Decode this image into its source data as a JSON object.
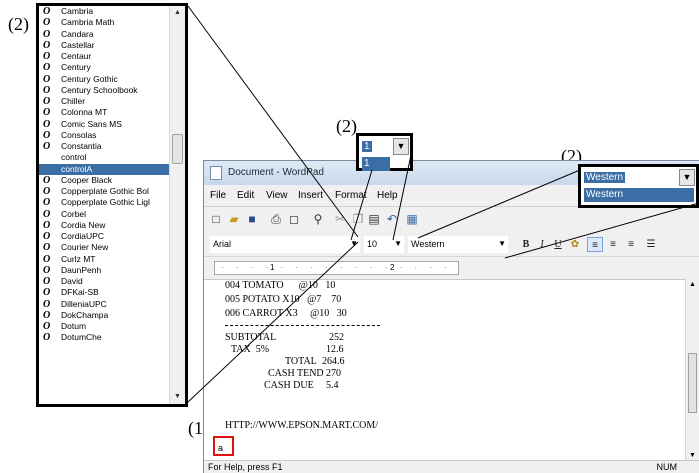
{
  "annotations": {
    "list_label": "(2)",
    "size_label": "(2)",
    "script_label": "(2)",
    "cursor_label": "(1)"
  },
  "font_list": {
    "items": [
      {
        "name": "Cambria",
        "icon": "opentype-icon",
        "state": "normal"
      },
      {
        "name": "Cambria Math",
        "icon": "opentype-icon",
        "state": "normal"
      },
      {
        "name": "Candara",
        "icon": "opentype-icon",
        "state": "normal"
      },
      {
        "name": "Castellar",
        "icon": "opentype-icon",
        "state": "normal"
      },
      {
        "name": "Centaur",
        "icon": "opentype-icon",
        "state": "normal"
      },
      {
        "name": "Century",
        "icon": "opentype-icon",
        "state": "normal"
      },
      {
        "name": "Century Gothic",
        "icon": "opentype-icon",
        "state": "normal"
      },
      {
        "name": "Century Schoolbook",
        "icon": "opentype-icon",
        "state": "normal"
      },
      {
        "name": "Chiller",
        "icon": "opentype-icon",
        "state": "normal"
      },
      {
        "name": "Colonna MT",
        "icon": "opentype-icon",
        "state": "normal"
      },
      {
        "name": "Comic Sans MS",
        "icon": "opentype-icon",
        "state": "normal"
      },
      {
        "name": "Consolas",
        "icon": "opentype-icon",
        "state": "normal"
      },
      {
        "name": "Constantia",
        "icon": "opentype-icon",
        "state": "normal"
      },
      {
        "name": "control",
        "icon": "",
        "state": "plain"
      },
      {
        "name": "controlA",
        "icon": "",
        "state": "selected"
      },
      {
        "name": "Cooper Black",
        "icon": "opentype-icon",
        "state": "normal"
      },
      {
        "name": "Copperplate Gothic Bol",
        "icon": "opentype-icon",
        "state": "normal"
      },
      {
        "name": "Copperplate Gothic Ligl",
        "icon": "opentype-icon",
        "state": "normal"
      },
      {
        "name": "Corbel",
        "icon": "opentype-icon",
        "state": "normal"
      },
      {
        "name": "Cordia New",
        "icon": "opentype-icon",
        "state": "normal"
      },
      {
        "name": "CordiaUPC",
        "icon": "opentype-icon",
        "state": "normal"
      },
      {
        "name": "Courier New",
        "icon": "opentype-icon",
        "state": "normal"
      },
      {
        "name": "Curlz MT",
        "icon": "opentype-icon",
        "state": "normal"
      },
      {
        "name": "DaunPenh",
        "icon": "opentype-icon",
        "state": "normal"
      },
      {
        "name": "David",
        "icon": "opentype-icon",
        "state": "normal"
      },
      {
        "name": "DFKai-SB",
        "icon": "opentype-icon",
        "state": "normal"
      },
      {
        "name": "DilleniaUPC",
        "icon": "opentype-icon",
        "state": "normal"
      },
      {
        "name": "DokChampa",
        "icon": "opentype-icon",
        "state": "normal"
      },
      {
        "name": "Dotum",
        "icon": "opentype-icon",
        "state": "normal"
      },
      {
        "name": "DotumChe",
        "icon": "opentype-icon",
        "state": "normal"
      }
    ],
    "icon_glyph": "O"
  },
  "window": {
    "title": "Document - WordPad",
    "menu": [
      "File",
      "Edit",
      "View",
      "Insert",
      "Format",
      "Help"
    ],
    "font_combo": "Arial",
    "size_combo": "10",
    "script_combo": "Western",
    "ruler_numbers": [
      "1",
      "2"
    ],
    "status_left": "For Help, press F1",
    "status_right": "NUM"
  },
  "document": {
    "items": [
      {
        "text": "004 TOMATO      @10   10"
      },
      {
        "text": "005 POTATO X10   @7    70"
      },
      {
        "text": "006 CARROT X3     @10   30"
      }
    ],
    "subtotal_label": "SUBTOTAL",
    "subtotal_value": "252",
    "tax_label": "TAX  5%",
    "tax_value": "12.6",
    "total_label": "TOTAL",
    "total_value": "264.6",
    "cash_tend_label": "CASH TEND",
    "cash_tend_value": "270",
    "cash_due_label": "CASH DUE",
    "cash_due_value": "5.4",
    "url": "HTTP://WWW.EPSON.MART.COM/",
    "cursor_text": "a"
  },
  "zoom_size": {
    "input": "1",
    "list_item": "1"
  },
  "zoom_script": {
    "input": "Western",
    "list_item": "Western"
  }
}
